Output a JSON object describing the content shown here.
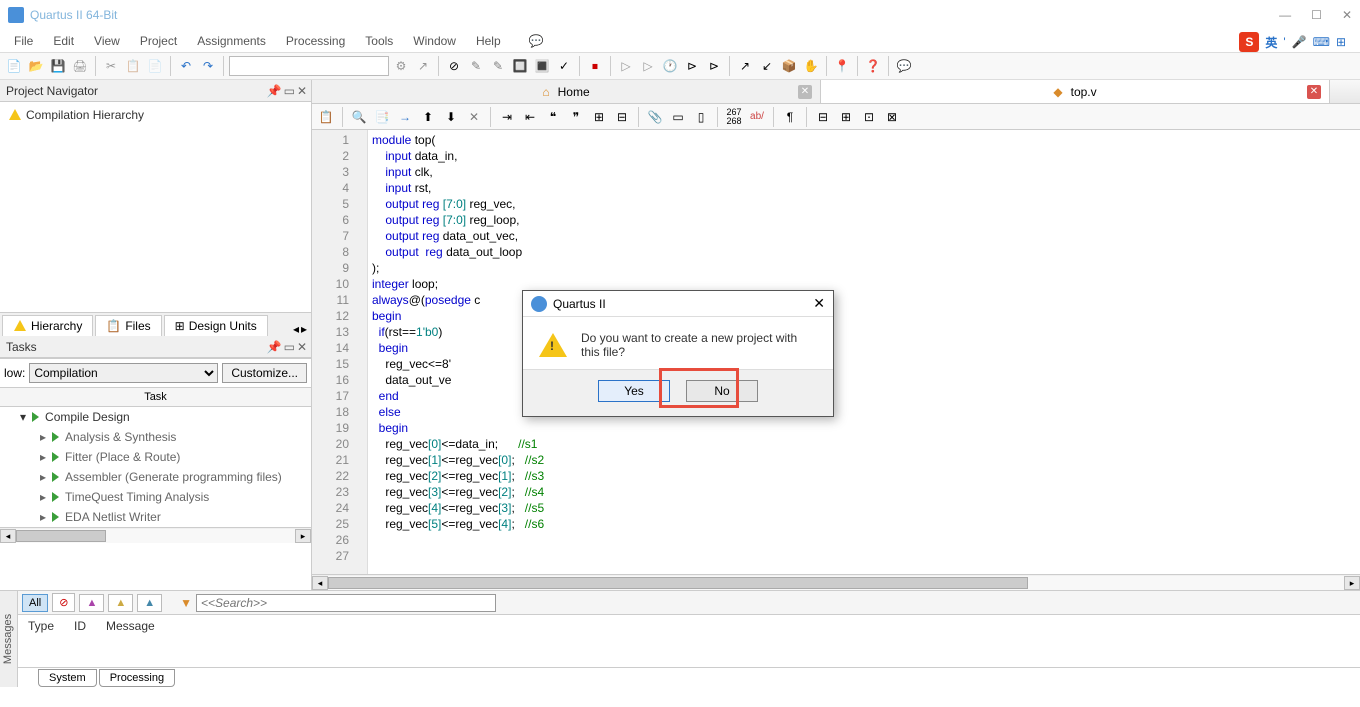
{
  "window": {
    "title": "Quartus II 64-Bit"
  },
  "menu": [
    "File",
    "Edit",
    "View",
    "Project",
    "Assignments",
    "Processing",
    "Tools",
    "Window",
    "Help"
  ],
  "panels": {
    "navigator": "Project Navigator",
    "compilation": "Compilation Hierarchy",
    "tabs": {
      "hierarchy": "Hierarchy",
      "files": "Files",
      "design": "Design Units"
    },
    "tasks": "Tasks",
    "flow_label": "low:",
    "flow_value": "Compilation",
    "customize": "Customize...",
    "task_header": "Task",
    "task_root": "Compile Design",
    "task_items": [
      "Analysis & Synthesis",
      "Fitter (Place & Route)",
      "Assembler (Generate programming files)",
      "TimeQuest Timing Analysis",
      "EDA Netlist Writer"
    ]
  },
  "editor": {
    "tabs": {
      "home": "Home",
      "file": "top.v"
    },
    "lines": [
      1,
      2,
      3,
      4,
      5,
      6,
      7,
      8,
      9,
      10,
      11,
      12,
      13,
      14,
      15,
      16,
      17,
      18,
      19,
      20,
      21,
      22,
      23,
      24,
      25,
      26,
      27
    ],
    "code_raw": "module top(\n    input data_in,\n    input clk,\n    input rst,\n    output reg [7:0] reg_vec,\n    output reg [7:0] reg_loop,\n    output reg data_out_vec,\n    output  reg data_out_loop\n);\ninteger loop;\n\n\nalways@(posedge c\nbegin\n  if(rst==1'b0)\n  begin\n    reg_vec<=8'\n    data_out_ve\n  end\n  else\n  begin\n    reg_vec[0]<=data_in;      //s1\n    reg_vec[1]<=reg_vec[0];   //s2\n    reg_vec[2]<=reg_vec[1];   //s3\n    reg_vec[3]<=reg_vec[2];   //s4\n    reg_vec[4]<=reg_vec[3];   //s5\n    reg_vec[5]<=reg_vec[4];   //s6"
  },
  "dialog": {
    "title": "Quartus II",
    "message": "Do you want to create a new project with this file?",
    "yes": "Yes",
    "no": "No"
  },
  "messages": {
    "all": "All",
    "search": "<<Search>>",
    "columns": {
      "type": "Type",
      "id": "ID",
      "msg": "Message"
    },
    "tabs": {
      "system": "System",
      "processing": "Processing"
    },
    "vert": "Messages"
  },
  "ime": {
    "lang": "英"
  }
}
